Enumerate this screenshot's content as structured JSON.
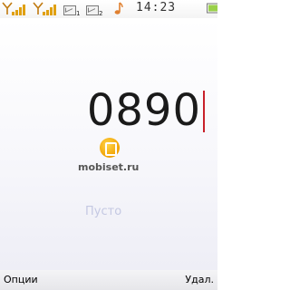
{
  "status_bar": {
    "sim1_label": "1",
    "sim2_label": "2",
    "music_icon": "music-note-icon",
    "time": "14:23",
    "signal_color": "#e0a010"
  },
  "main": {
    "dialed_number": "0890",
    "empty_label": "Пусто",
    "cursor_color": "#c8202a"
  },
  "watermark": {
    "text": "mobiset.ru"
  },
  "softkeys": {
    "left": "Опции",
    "right": "Удал."
  }
}
